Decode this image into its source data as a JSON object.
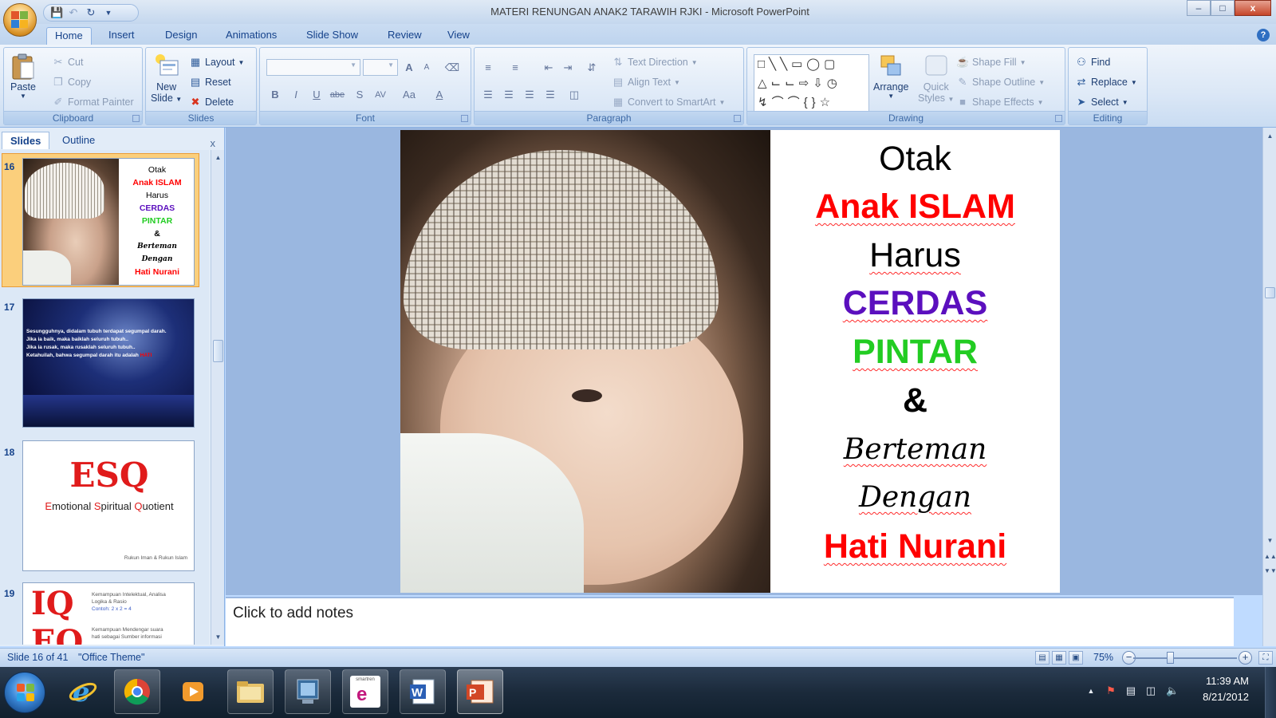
{
  "window": {
    "title": "MATERI RENUNGAN ANAK2 TARAWIH RJKI - Microsoft PowerPoint",
    "minimize": "–",
    "maximize": "□",
    "close": "x"
  },
  "qat": [
    "save-icon",
    "undo-icon",
    "redo-icon",
    "customize-icon"
  ],
  "tabs": [
    "Home",
    "Insert",
    "Design",
    "Animations",
    "Slide Show",
    "Review",
    "View"
  ],
  "active_tab": "Home",
  "ribbon": {
    "clipboard": {
      "label": "Clipboard",
      "paste": "Paste",
      "cut": "Cut",
      "copy": "Copy",
      "format_painter": "Format Painter"
    },
    "slides": {
      "label": "Slides",
      "new_slide_line1": "New",
      "new_slide_line2": "Slide",
      "layout": "Layout",
      "reset": "Reset",
      "delete": "Delete"
    },
    "font": {
      "label": "Font",
      "bold": "B",
      "italic": "I",
      "underline": "U",
      "strike": "abe",
      "shadow": "S",
      "spacing": "AV",
      "case": "Aa",
      "color": "A",
      "grow": "A",
      "shrink": "A"
    },
    "paragraph": {
      "label": "Paragraph",
      "text_direction": "Text Direction",
      "align_text": "Align Text",
      "convert_smartart": "Convert to SmartArt"
    },
    "drawing": {
      "label": "Drawing",
      "arrange": "Arrange",
      "quick_styles_line1": "Quick",
      "quick_styles_line2": "Styles",
      "shape_fill": "Shape Fill",
      "shape_outline": "Shape Outline",
      "shape_effects": "Shape Effects"
    },
    "editing": {
      "label": "Editing",
      "find": "Find",
      "replace": "Replace",
      "select": "Select"
    }
  },
  "left_panel": {
    "tabs": [
      "Slides",
      "Outline"
    ],
    "active": "Slides",
    "close": "x",
    "thumbnails": [
      {
        "number": "16",
        "selected": true,
        "lines": [
          "Otak",
          "Anak ISLAM",
          "Harus",
          "CERDAS",
          "PINTAR",
          "&",
          "Berteman",
          "Dengan",
          "Hati Nurani"
        ]
      },
      {
        "number": "17",
        "selected": false,
        "lines": [
          "Sesungguhnya, didalam tubuh terdapat segumpal darah.",
          "Jika ia baik, maka baiklah seluruh tubuh..",
          "Jika ia rusak, maka rusaklah seluruh tubuh..",
          "Ketahuilah, bahwa segumpal darah itu adalah",
          "HATI"
        ]
      },
      {
        "number": "18",
        "selected": false,
        "title": "ESQ",
        "subtitle_parts": [
          "E",
          "motional ",
          "S",
          "piritual ",
          "Q",
          "uotient"
        ],
        "footer": "Rukun Iman & Rukun Islam"
      },
      {
        "number": "19",
        "selected": false,
        "title1": "IQ",
        "title2": "EQ",
        "lines": [
          "Kemampuan Intelektual, Analisa",
          "Logika & Rasio",
          "Contoh: 2 x 2 = 4",
          "Kemampuan Mendengar suara",
          "hati sebagai Sumber informasi"
        ]
      }
    ]
  },
  "slide": {
    "lines": [
      {
        "text": "Otak",
        "color": "#000000",
        "style": "normal"
      },
      {
        "text": "Anak ISLAM",
        "color": "#ff0000",
        "style": "bold"
      },
      {
        "text": "Harus",
        "color": "#000000",
        "style": "normal"
      },
      {
        "text": "CERDAS",
        "color": "#5b0fbe",
        "style": "bold"
      },
      {
        "text": "PINTAR",
        "color": "#22cc22",
        "style": "bold"
      },
      {
        "text": "&",
        "color": "#000000",
        "style": "bold"
      },
      {
        "text": "Berteman",
        "color": "#000000",
        "style": "script"
      },
      {
        "text": "Dengan",
        "color": "#000000",
        "style": "script"
      },
      {
        "text": "Hati Nurani",
        "color": "#ff0000",
        "style": "bold"
      }
    ]
  },
  "notes": {
    "placeholder": "Click to add notes"
  },
  "status": {
    "slide_info": "Slide 16 of 41",
    "theme": "\"Office Theme\"",
    "zoom": "75%",
    "zoom_level_percent": 75
  },
  "taskbar": {
    "apps": [
      "internet-explorer-icon",
      "chrome-icon",
      "media-player-icon",
      "file-explorer-icon",
      "app-icon",
      "smartren-icon",
      "word-icon",
      "powerpoint-icon"
    ],
    "smartren_label": "smartren",
    "time": "11:39 AM",
    "date": "8/21/2012"
  }
}
